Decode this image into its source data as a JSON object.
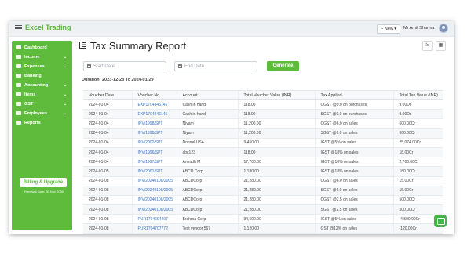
{
  "app": {
    "brand": "Excel Trading",
    "new_label": "+ New ▾",
    "user_name": "Mr Amit Sharma"
  },
  "sidebar": {
    "items": [
      {
        "label": "Dashboard",
        "icon": "dashboard-icon",
        "chevron": ""
      },
      {
        "label": "Income",
        "icon": "income-icon",
        "chevron": "⌄"
      },
      {
        "label": "Expenses",
        "icon": "expenses-icon",
        "chevron": "⌄"
      },
      {
        "label": "Banking",
        "icon": "bank-icon",
        "chevron": ""
      },
      {
        "label": "Accounting",
        "icon": "accounting-icon",
        "chevron": "⌄"
      },
      {
        "label": "Items",
        "icon": "items-icon",
        "chevron": "⌄"
      },
      {
        "label": "GST",
        "icon": "gst-icon",
        "chevron": "⌄"
      },
      {
        "label": "Employees",
        "icon": "employees-icon",
        "chevron": "⌄"
      },
      {
        "label": "Reports",
        "icon": "reports-icon",
        "chevron": ""
      }
    ],
    "billing_label": "Billing & Upgrade",
    "renewal": "Renewal Date: 30 Nov 2050"
  },
  "page": {
    "title": "Tax Summary Report",
    "start_placeholder": "Start Date",
    "end_placeholder": "End Date",
    "generate_label": "Generate",
    "duration": "Duration: 2023-12-28 To 2024-01-29"
  },
  "table": {
    "headers": [
      "Voucher Date",
      "Voucher No",
      "Account",
      "Total Voucher Value (INR)",
      "Tax Applied",
      "Total Tax Value (INR)"
    ],
    "rows": [
      [
        "2024-01-04",
        "EXP1704346145",
        "Cash in hand",
        "118.00",
        "CGST @9.0 on purchases",
        "9.00Dr"
      ],
      [
        "2024-01-04",
        "EXP1704346145",
        "Cash in hand",
        "118.00",
        "SGST @9.0 on purchases",
        "9.00Dr"
      ],
      [
        "2024-01-04",
        "INV/1998/SPT",
        "Niyam",
        "11,200.00",
        "CGST @6.0 on sales",
        "600.00Cr"
      ],
      [
        "2024-01-04",
        "INV/1998/SPT",
        "Niyam",
        "11,200.00",
        "SGST @6.0 on sales",
        "600.00Cr"
      ],
      [
        "2024-01-04",
        "INV/2000/SPT",
        "Donnel USA",
        "9,450.00",
        "IGST @5% on sales",
        "25,074.00Cr"
      ],
      [
        "2024-01-04",
        "INV/1996/SPT",
        "abc123",
        "118.00",
        "IGST @18% on sales",
        "18.00Cr"
      ],
      [
        "2024-01-04",
        "INV/1997/SPT",
        "Anirudh M",
        "17,700.00",
        "IGST @18% on sales",
        "2,700.00Cr"
      ],
      [
        "2024-01-05",
        "INV/2001/SPT",
        "ABCD Corp",
        "1,180.00",
        "IGST @18% on sales",
        "180.00Cr"
      ],
      [
        "2024-01-08",
        "INV/20240108/2005",
        "ABCDCorp",
        "21,280.00",
        "CGST @6.0 on sales",
        "15.00Cr"
      ],
      [
        "2024-01-08",
        "INV/20240108/2005",
        "ABCDCorp",
        "21,280.00",
        "SGST @6.0 on sales",
        "15.00Cr"
      ],
      [
        "2024-01-08",
        "INV/20240108/2005",
        "ABCDCorp",
        "21,280.00",
        "CGST @2.5 on sales",
        "500.00Cr"
      ],
      [
        "2024-01-08",
        "INV/20240108/2005",
        "ABCDCorp",
        "21,280.00",
        "SGST @2.5 on sales",
        "500.00Cr"
      ],
      [
        "2024-01-08",
        "PUR1704694207",
        "Brahma Corp",
        "94,500.00",
        "IGST @5% on sales",
        "-4,500.00Cr"
      ],
      [
        "2024-01-08",
        "PUR1704707772",
        "Test vendor 567",
        "1,120.00",
        "GST @12% on sales",
        "-120.00Cr"
      ]
    ]
  },
  "colors": {
    "brand_green": "#5ebb3b",
    "link_blue": "#3a73c9"
  }
}
